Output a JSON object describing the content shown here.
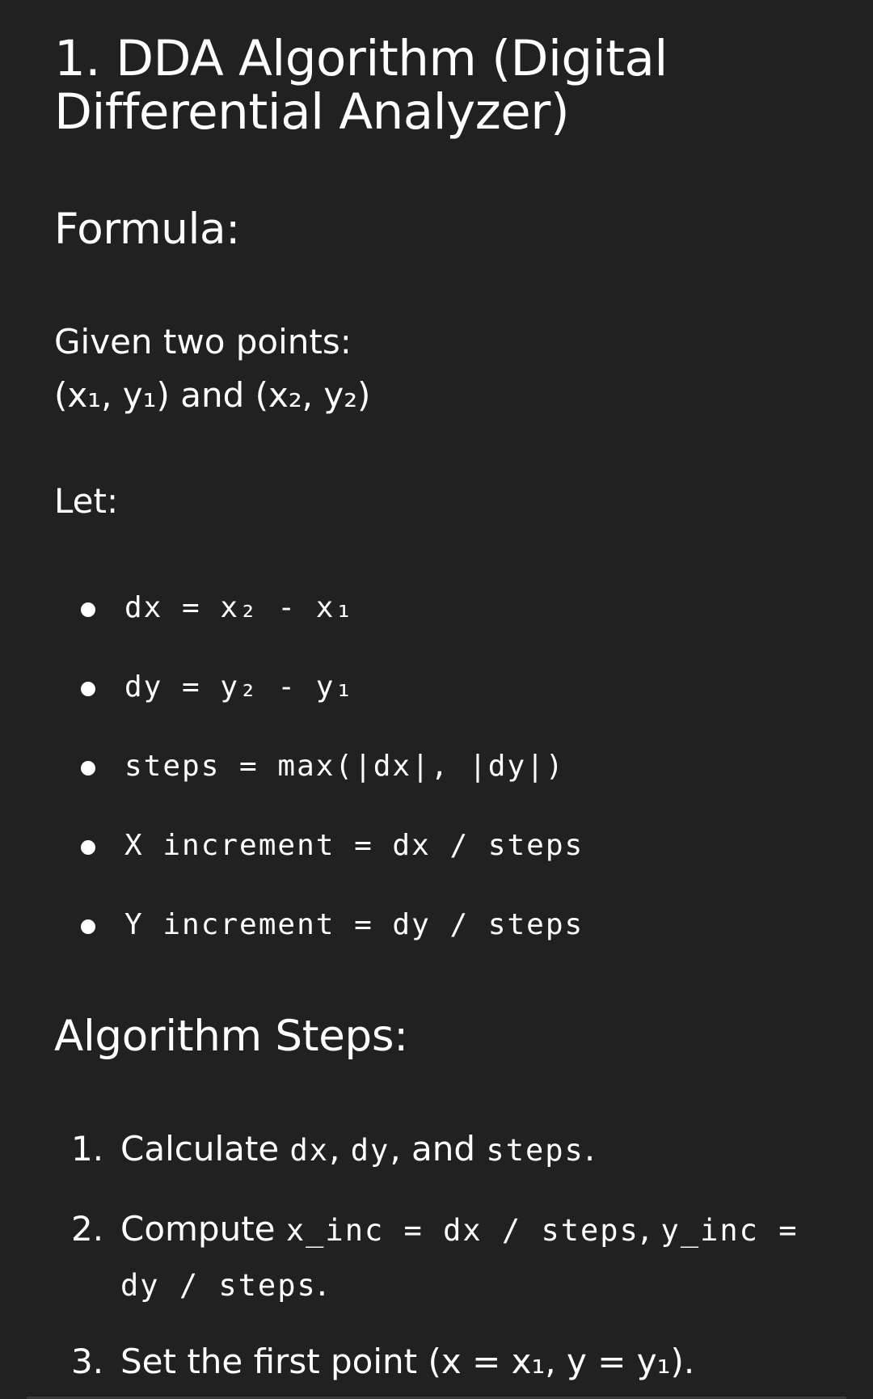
{
  "doc": {
    "title": "1. DDA Algorithm (Digital Differential Analyzer)",
    "formula_heading": "Formula:",
    "given_label": "Given two points:",
    "given_points": "(x₁, y₁) and (x₂, y₂)",
    "let_label": "Let:",
    "definitions": [
      "dx = x₂ - x₁",
      "dy = y₂ - y₁",
      "steps = max(|dx|, |dy|)",
      "X increment = dx / steps",
      "Y increment = dy / steps"
    ],
    "steps_heading": "Algorithm Steps:",
    "steps": [
      {
        "num": "1.",
        "text1": "Calculate ",
        "code1": "dx",
        "text2": ", ",
        "code2": "dy",
        "text3": ", and ",
        "code3": "steps",
        "text4": "."
      },
      {
        "num": "2.",
        "text1": "Compute ",
        "code1": "x_inc = dx / steps",
        "text2": ", ",
        "code2": "y_inc = dy / steps",
        "text3": "."
      },
      {
        "num": "3.",
        "text1": "Set the first point (x = x₁, y = y₁)."
      }
    ]
  }
}
